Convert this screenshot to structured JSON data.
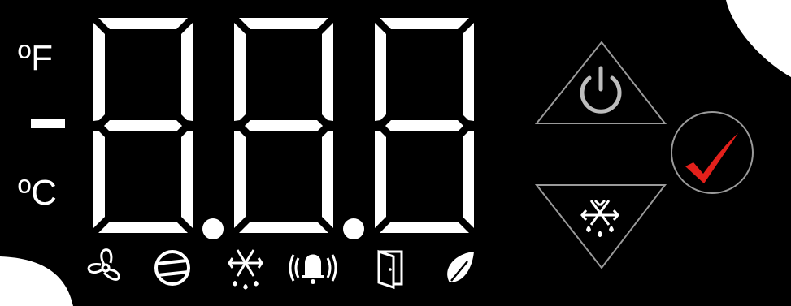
{
  "display": {
    "unit_fahrenheit": "ºF",
    "unit_celsius": "ºC",
    "digits": [
      "8",
      "8",
      "8"
    ],
    "decimal_points": 2
  },
  "status_icons": [
    "fan-icon",
    "compressor-icon",
    "defrost-icon",
    "alarm-icon",
    "door-icon",
    "eco-leaf-icon"
  ],
  "buttons": {
    "power": "power-icon",
    "confirm": "checkmark-icon",
    "defrost": "defrost-icon"
  },
  "colors": {
    "panel": "#000000",
    "segment": "#ffffff",
    "button_outline": "#9a9a9a",
    "power_icon": "#bdbdbd",
    "check": "#e3201b"
  }
}
